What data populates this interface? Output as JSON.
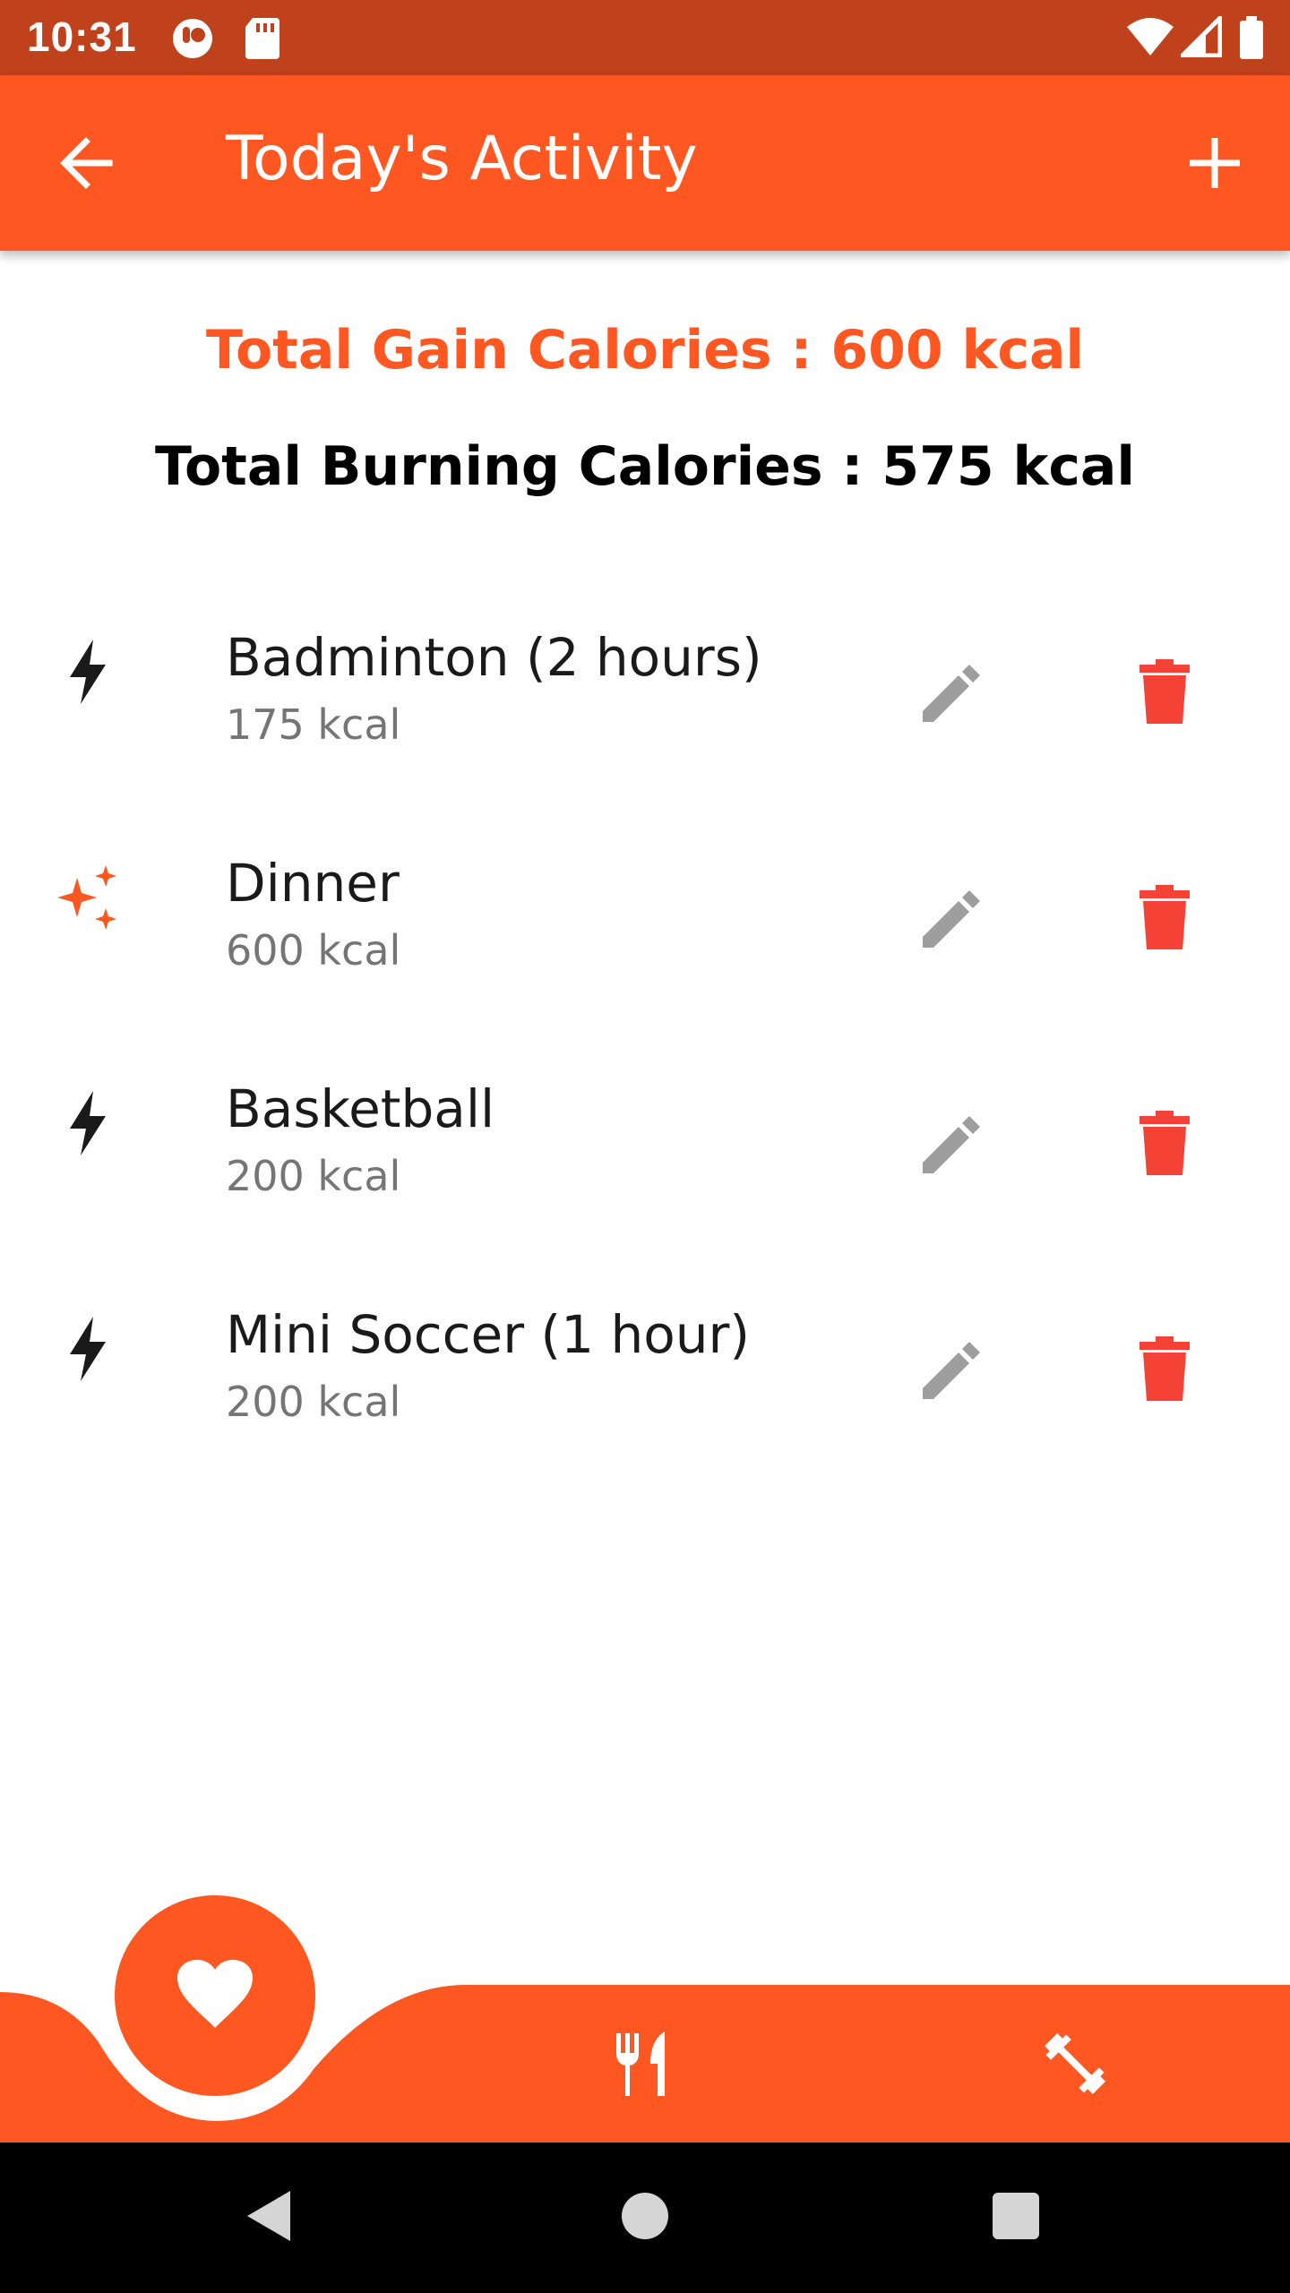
{
  "status_bar": {
    "time": "10:31"
  },
  "app_bar": {
    "title": "Today's Activity"
  },
  "totals": {
    "gain": "Total Gain Calories : 600 kcal",
    "burn": "Total Burning Calories : 575 kcal"
  },
  "activities": [
    {
      "title": "Badminton (2 hours)",
      "kcal": "175  kcal",
      "kind": "bolt-icon"
    },
    {
      "title": "Dinner",
      "kcal": "600  kcal",
      "kind": "sparkle-icon"
    },
    {
      "title": "Basketball",
      "kcal": "200  kcal",
      "kind": "bolt-icon"
    },
    {
      "title": "Mini Soccer (1 hour)",
      "kcal": "200  kcal",
      "kind": "bolt-icon"
    }
  ],
  "colors": {
    "status_bar": "#bf421c",
    "primary": "#ff5722",
    "delete": "#f44336",
    "edit": "#9e9e9e"
  }
}
